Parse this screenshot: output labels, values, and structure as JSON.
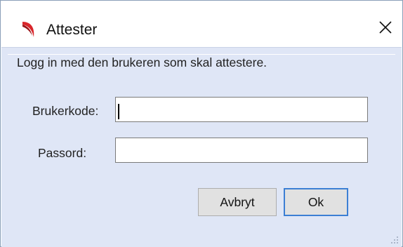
{
  "window": {
    "title": "Attester",
    "app_icon": "red-swoosh-logo",
    "close_icon": "close-icon",
    "close_glyph": "✕"
  },
  "form": {
    "instruction": "Logg in med den brukeren som skal attestere.",
    "username_label": "Brukerkode:",
    "username_value": "",
    "password_label": "Passord:",
    "password_value": ""
  },
  "buttons": {
    "cancel_label": "Avbryt",
    "ok_label": "Ok"
  },
  "colors": {
    "body_background": "#dfe6f6",
    "accent_focus": "#3c7fd4",
    "logo_red": "#d9262b"
  }
}
